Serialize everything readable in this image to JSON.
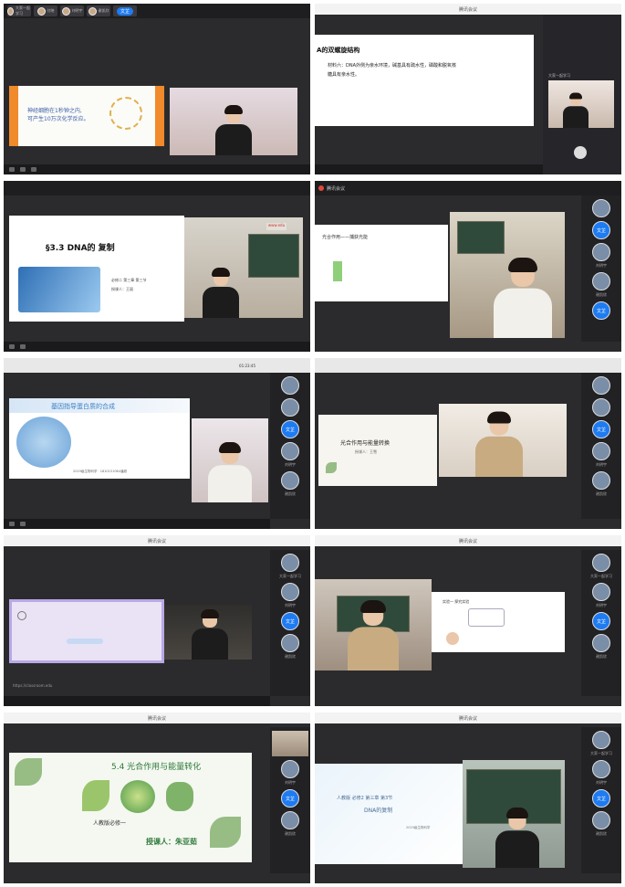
{
  "app": {
    "meeting_label": "腾讯会议"
  },
  "cell1": {
    "participants": [
      "大家一起学习",
      "付晓",
      "刘明宇",
      "谢凯欣",
      "文芷"
    ],
    "slide_line1": "神经细胞在1秒钟之内,",
    "slide_line2": "可产生10万次化学反应。"
  },
  "cell2": {
    "title": "A的双螺旋结构",
    "body_line1": "材料六：DNA外侧为亲水环境，碱基具有疏水性，磷酸和脱氧核",
    "body_line2": "糖具有亲水性。",
    "side_label": "大家一起学习"
  },
  "cell3": {
    "title": "§3.3    DNA的 复制",
    "subtitle1": "必修二 第三章 第三节",
    "subtitle2": "授课人：王丽",
    "board_label": "www.edu"
  },
  "cell4": {
    "slide_title": "光合作用——捕获光能",
    "side": [
      "文芷",
      "刘明宇",
      "谢凯欣",
      "文芷"
    ]
  },
  "cell5": {
    "slide_title": "基因指导蛋白质的合成",
    "footer": "2019级生物科学 ·  1810151064潘超",
    "status": "01:23:45",
    "side": [
      "文芷",
      "刘明宇",
      "谢凯欣"
    ]
  },
  "cell6": {
    "slide_title": "光合作用与能量转换",
    "slide_sub": "授课人：王雪",
    "side": [
      "文芷",
      "刘明宇",
      "谢凯欣"
    ]
  },
  "cell7": {
    "url": "https://classroom.edu",
    "side": [
      "大家一起学习",
      "刘明宇",
      "文芷",
      "谢凯欣"
    ]
  },
  "cell8": {
    "slide_title": "实验一 探究实验",
    "side": [
      "大家一起学习",
      "刘明宇",
      "文芷",
      "谢凯欣"
    ]
  },
  "cell9": {
    "slide_title": "5.4 光合作用与能量转化",
    "version": "人教版必修一",
    "teacher": "授课人：朱亚茹",
    "side": [
      "刘明宇",
      "文芷",
      "谢凯欣"
    ]
  },
  "cell10": {
    "slide_line1": "人教版 必修2 第三章 第3节",
    "slide_line2": "DNA的复制",
    "slide_sub": "2019级生物科学",
    "side": [
      "大家一起学习",
      "刘明宇",
      "文芷",
      "谢凯欣"
    ]
  },
  "colors": {
    "accent_blue": "#1e7bf2",
    "toolbar": "#1e1e20",
    "orange": "#f08a2a"
  }
}
